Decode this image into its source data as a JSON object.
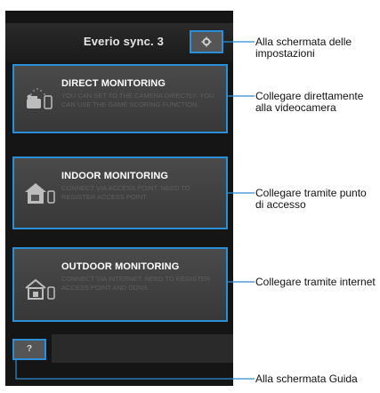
{
  "app": {
    "title": "Everio sync. 3"
  },
  "modes": [
    {
      "title": "DIRECT MONITORING",
      "description": "YOU CAN SET TO THE CAMERA DIRECTLY. YOU CAN USE THE GAME SCORING FUNCTION.",
      "icon": "camcorder-direct-icon"
    },
    {
      "title": "INDOOR MONITORING",
      "description": "CONNECT VIA ACCESS POINT. NEED TO REGISTER ACCESS POINT.",
      "icon": "home-accesspoint-icon"
    },
    {
      "title": "OUTDOOR MONITORING",
      "description": "CONNECT VIA INTERNET. NEED TO REGISTER ACCESS POINT AND DDNS.",
      "icon": "home-internet-icon"
    }
  ],
  "help": {
    "label": "?"
  },
  "callouts": {
    "settings": "Alla schermata delle impostazioni",
    "direct": "Collegare direttamente alla videocamera",
    "indoor": "Collegare tramite punto di accesso",
    "outdoor": "Collegare tramite internet",
    "guide": "Alla schermata Guida"
  },
  "colors": {
    "accent": "#2a8fd8",
    "background": "#151515",
    "tile": "#424242"
  }
}
